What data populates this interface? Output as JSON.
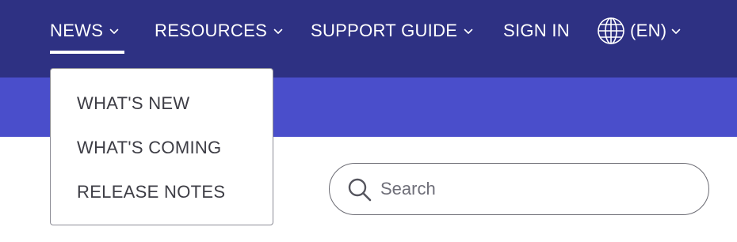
{
  "nav": {
    "items": [
      {
        "label": "NEWS"
      },
      {
        "label": "RESOURCES"
      },
      {
        "label": "SUPPORT GUIDE"
      },
      {
        "label": "SIGN IN"
      }
    ],
    "language": {
      "label": "(EN)",
      "icon": "globe-icon"
    }
  },
  "news_menu": {
    "items": [
      {
        "label": "WHAT'S NEW"
      },
      {
        "label": "WHAT'S COMING"
      },
      {
        "label": "RELEASE NOTES"
      }
    ]
  },
  "search": {
    "placeholder": "Search",
    "value": "",
    "icon": "search-icon"
  },
  "colors": {
    "nav_bg": "#2e3183",
    "banner_bg": "#4a4ecb",
    "nav_text": "#ffffff",
    "menu_text": "#3d3d45"
  }
}
